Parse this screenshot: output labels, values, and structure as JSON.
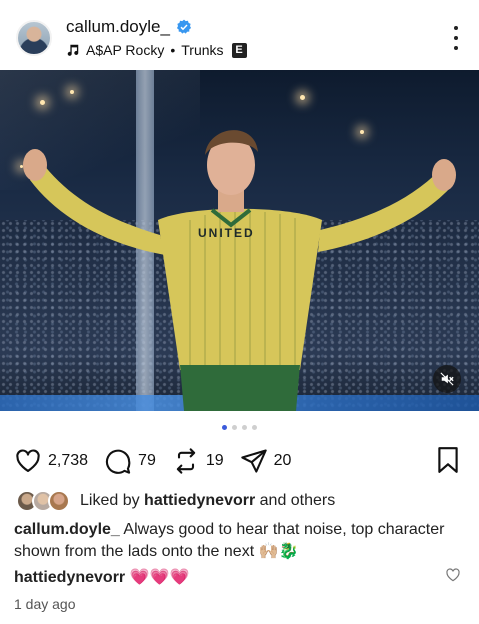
{
  "header": {
    "username": "callum.doyle_",
    "verified": true,
    "music": {
      "artist": "A$AP Rocky",
      "separator": "•",
      "track": "Trunks",
      "explicit": "E"
    }
  },
  "media": {
    "sponsor_text": "UNITED",
    "muted": true,
    "carousel": {
      "count": 4,
      "active": 0
    }
  },
  "actions": {
    "likes": "2,738",
    "comments": "79",
    "reposts": "19",
    "shares": "20"
  },
  "liked_by": {
    "prefix": "Liked by",
    "user": "hattiedynevorr",
    "suffix": "and others"
  },
  "caption": {
    "user": "callum.doyle_",
    "text": "Always good to hear that noise, top character shown from the lads onto the next 🙌🏼🐉"
  },
  "top_comment": {
    "user": "hattiedynevorr",
    "text": "💗💗💗"
  },
  "timestamp": "1 day ago",
  "colors": {
    "accent": "#3b5bdb",
    "verified": "#3897f0",
    "shirt": "#d6c65a",
    "stripe": "#2f6b3a"
  }
}
